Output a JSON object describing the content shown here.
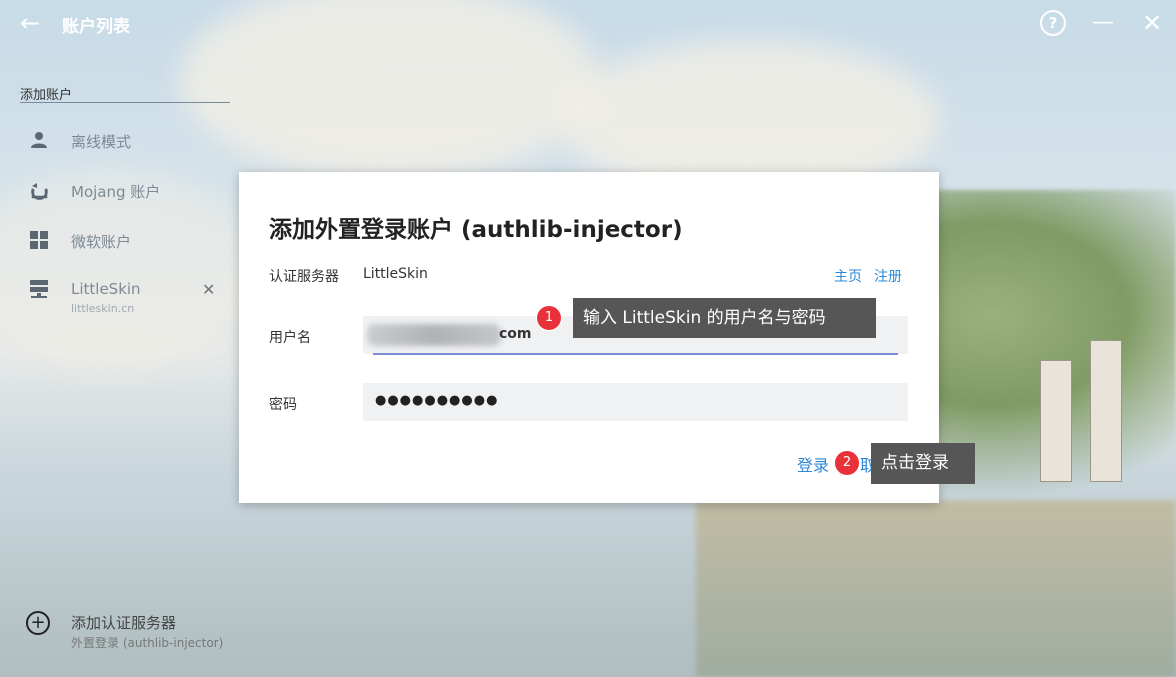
{
  "app": {
    "title": "账户列表",
    "back_icon": "arrow-left-icon",
    "help_icon": "help-circle-icon",
    "minimize_icon": "minimize-icon",
    "close_icon": "close-icon"
  },
  "sidebar": {
    "add_account_label": "添加账户",
    "items": [
      {
        "label": "离线模式",
        "icon": "user-icon"
      },
      {
        "label": "Mojang 账户",
        "icon": "mojang-icon"
      },
      {
        "label": "微软账户",
        "icon": "windows-icon"
      },
      {
        "label": "LittleSkin",
        "sub": "littleskin.cn",
        "icon": "server-icon",
        "remove_glyph": "✕"
      }
    ],
    "add_server": {
      "label": "添加认证服务器",
      "sub": "外置登录 (authlib-injector)",
      "icon": "plus-circle-icon"
    }
  },
  "dialog": {
    "title": "添加外置登录账户 (authlib-injector)",
    "server_label": "认证服务器",
    "server_value": "LittleSkin",
    "link_home": "主页",
    "link_register": "注册",
    "username_label": "用户名",
    "username_value_suffix": "com",
    "password_label": "密码",
    "password_value": "●●●●●●●●●●",
    "login_button": "登录",
    "cancel_button": "取消"
  },
  "annotations": [
    {
      "number": "1",
      "text": "输入 LittleSkin 的用户名与密码"
    },
    {
      "number": "2",
      "text": "点击登录"
    }
  ],
  "colors": {
    "accent": "#2b88d8",
    "badge": "#e8323a",
    "tooltip": "#565656",
    "input_bg": "#f0f1f3",
    "underline": "#7a8ed8"
  }
}
